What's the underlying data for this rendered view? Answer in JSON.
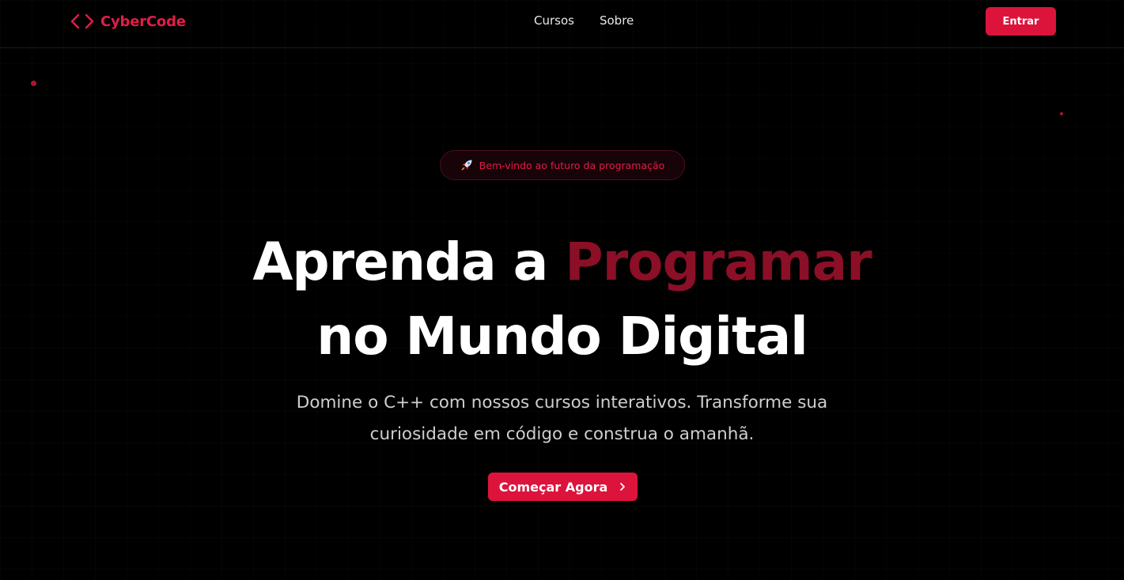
{
  "header": {
    "logo_text": "CyberCode",
    "logo_icon": "code-brackets-icon",
    "nav": [
      {
        "label": "Cursos"
      },
      {
        "label": "Sobre"
      }
    ],
    "login_label": "Entrar"
  },
  "hero": {
    "badge_icon": "rocket-icon",
    "badge_text": "Bem-vindo ao futuro da programação",
    "title_part1": "Aprenda a ",
    "title_accent": "Programar",
    "title_line2": "no Mundo Digital",
    "description": "Domine o C++ com nossos cursos interativos. Transforme sua curiosidade em código e construa o amanhã.",
    "cta_label": "Começar Agora",
    "cta_icon": "chevron-right-icon"
  },
  "colors": {
    "background": "#000000",
    "accent": "#dc143c",
    "accent_dark": "#8b0f26",
    "text": "#ffffff",
    "muted_text": "#cfcfcf"
  }
}
